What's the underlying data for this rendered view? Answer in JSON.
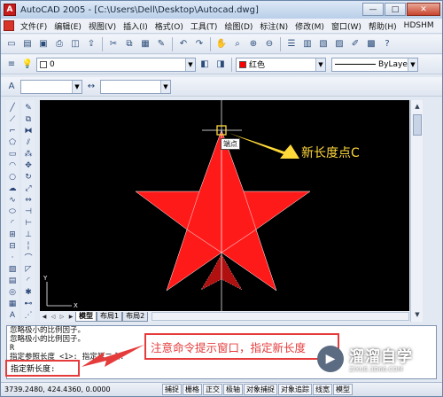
{
  "window": {
    "title": "AutoCAD 2005 - [C:\\Users\\Dell\\Desktop\\Autocad.dwg]",
    "app_icon_letter": "A",
    "minimize": "—",
    "maximize": "□",
    "close": "✕"
  },
  "menu": {
    "items": [
      "文件(F)",
      "编辑(E)",
      "视图(V)",
      "插入(I)",
      "格式(O)",
      "工具(T)",
      "绘图(D)",
      "标注(N)",
      "修改(M)",
      "窗口(W)",
      "帮助(H)",
      "HDSHM"
    ]
  },
  "layers": {
    "current_layer": "0",
    "color_value": "红色",
    "color_hex": "#ff0000",
    "linetype_value": "ByLayer"
  },
  "canvas": {
    "tooltip": "端点",
    "callout": "新长度点C",
    "star_color": "#ff1a1a",
    "callout_color": "#ffd83a"
  },
  "tabs": {
    "items": [
      "模型",
      "布局1",
      "布局2"
    ]
  },
  "command": {
    "lines": [
      "忽略极小的比例因子。",
      "忽略极小的比例因子。",
      "R",
      "指定参照长度 <1>:   指定第二点:"
    ],
    "prompt": "指定新长度:"
  },
  "annotation": {
    "text": "注意命令提示窗口，指定新长度"
  },
  "status": {
    "coords": "3739.2480, 424.4360, 0.0000",
    "buttons": [
      "捕捉",
      "栅格",
      "正交",
      "极轴",
      "对象捕捉",
      "对象追踪",
      "线宽",
      "模型"
    ]
  },
  "watermark": {
    "title": "溜溜自学",
    "url": "ZIXUE.3D66.COM"
  }
}
